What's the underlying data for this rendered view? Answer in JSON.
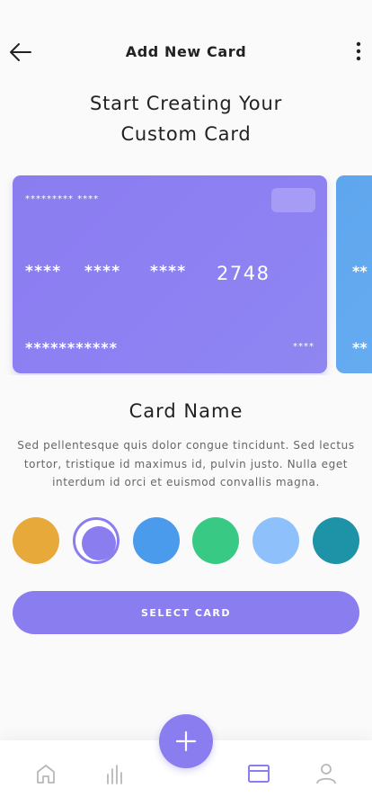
{
  "header": {
    "title": "Add New Card",
    "back_icon": "arrow-left-icon",
    "more_icon": "more-vertical-icon"
  },
  "hero": {
    "line1": "Start Creating Your",
    "line2": "Custom Card"
  },
  "cards": [
    {
      "top_mask": "********* ****",
      "groups": [
        "****",
        "****",
        "****"
      ],
      "last4": "2748",
      "holder_mask": "***********",
      "exp_mask": "****",
      "color": "#8a7df0"
    },
    {
      "groups": [
        "**"
      ],
      "holder_mask": "**",
      "color": "#6aaef2"
    }
  ],
  "card_name": "Card Name",
  "description": {
    "line1": "Sed pellentesque  quis dolor congue tincidunt. Sed lectus",
    "line2": "tortor, tristique id maximus id, pulvin justo. Nulla eget",
    "line3": "interdum id orci et euismod convallis magna."
  },
  "swatches": [
    {
      "color": "#e6a93a",
      "selected": false
    },
    {
      "color": "#8a7df0",
      "selected": true
    },
    {
      "color": "#4a9bec",
      "selected": false
    },
    {
      "color": "#38c985",
      "selected": false
    },
    {
      "color": "#8ec0fb",
      "selected": false
    },
    {
      "color": "#1e93a8",
      "selected": false
    }
  ],
  "select_button": {
    "label": "SELECT CARD"
  },
  "bottom_nav": {
    "items": [
      {
        "icon": "home-icon",
        "active": false
      },
      {
        "icon": "bar-chart-icon",
        "active": false
      },
      {
        "icon": "card-icon",
        "active": true
      },
      {
        "icon": "user-icon",
        "active": false
      }
    ],
    "fab_icon": "plus-icon",
    "active_color": "#8a7df0",
    "inactive_color": "#b8b8b8"
  }
}
